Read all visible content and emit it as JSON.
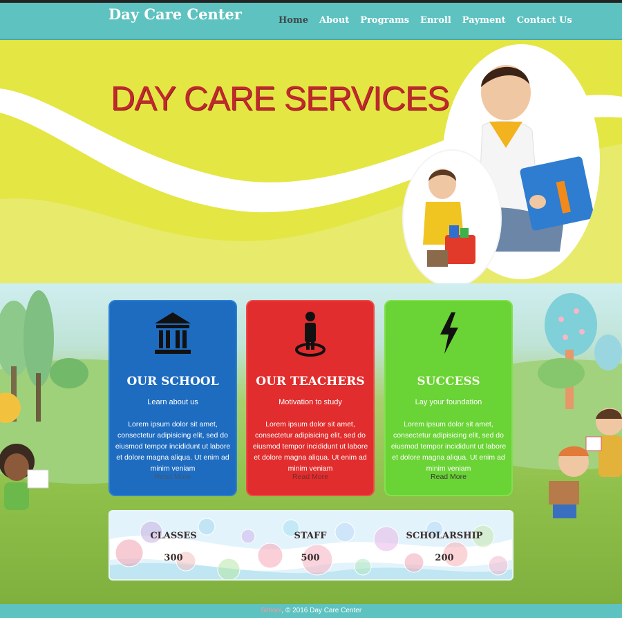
{
  "site": {
    "logo": "Day Care Center"
  },
  "nav": {
    "items": [
      "Home",
      "About",
      "Programs",
      "Enroll",
      "Payment",
      "Contact Us"
    ],
    "active": "Home"
  },
  "hero": {
    "title": "DAY CARE SERVICES"
  },
  "cards": [
    {
      "title": "OUR SCHOOL",
      "subtitle": "Learn about us",
      "body": "Lorem ipsum dolor sit amet, consectetur adipisicing elit, sed do eiusmod tempor incididunt ut labore et dolore magna aliqua. Ut enim ad minim veniam",
      "link": "Read More",
      "icon": "school-building-icon",
      "color": "#1e6cc0"
    },
    {
      "title": "OUR TEACHERS",
      "subtitle": "Motivation to study",
      "body": "Lorem ipsum dolor sit amet, consectetur adipisicing elit, sed do eiusmod tempor incididunt ut labore et dolore magna aliqua. Ut enim ad minim veniam",
      "link": "Read More",
      "icon": "person-pin-icon",
      "color": "#e12d2d"
    },
    {
      "title": "SUCCESS",
      "subtitle": "Lay your foundation",
      "body": "Lorem ipsum dolor sit amet, consectetur adipisicing elit, sed do eiusmod tempor incididunt ut labore et dolore magna aliqua. Ut enim ad minim veniam",
      "link": "Read More",
      "icon": "lightning-bolt-icon",
      "color": "#6ad335"
    }
  ],
  "stats": [
    {
      "label": "CLASSES",
      "value": "300"
    },
    {
      "label": "STAFF",
      "value": "500"
    },
    {
      "label": "SCHOLARSHIP",
      "value": "200"
    }
  ],
  "footer": {
    "link": "School",
    "text": ", © 2016 Day Care Center"
  },
  "colors": {
    "header": "#5ec2c0",
    "hero_bg": "#e6e64a",
    "hero_title": "#c0282d"
  }
}
